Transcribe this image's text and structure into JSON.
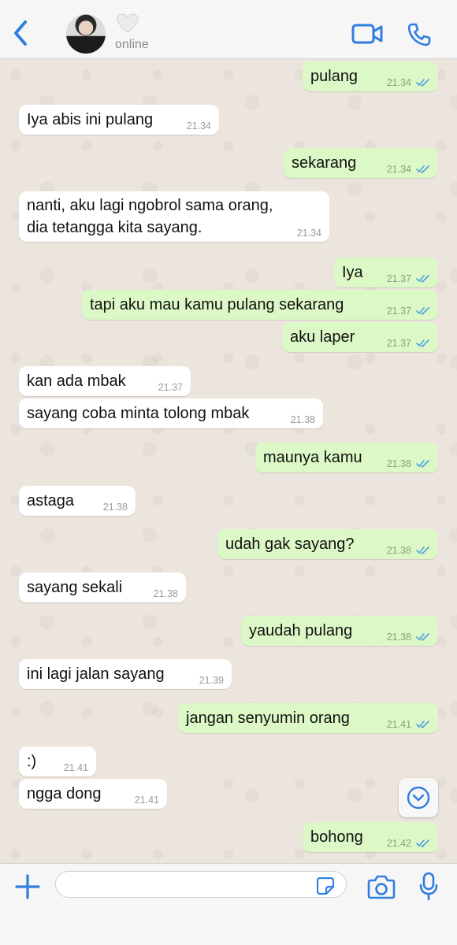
{
  "header": {
    "status": "online"
  },
  "icons": {
    "back": "chevron-left-icon",
    "heart": "heart-icon",
    "video": "video-camera-icon",
    "phone": "phone-icon",
    "plus": "plus-icon",
    "sticker": "sticker-icon",
    "camera": "camera-icon",
    "mic": "microphone-icon",
    "scroll": "chevron-down-circle-icon"
  },
  "colors": {
    "accent": "#2f7de1",
    "outgoing_bubble": "#dcf8c6",
    "incoming_bubble": "#ffffff",
    "tick_read": "#4fa3e0"
  },
  "messages": [
    {
      "dir": "out",
      "text": "pulang",
      "time": "21.34"
    },
    {
      "dir": "in",
      "text": "Iya abis ini pulang",
      "time": "21.34"
    },
    {
      "dir": "out",
      "text": "sekarang",
      "time": "21.34"
    },
    {
      "dir": "in",
      "text": "nanti, aku lagi ngobrol sama orang, dia tetangga kita sayang.",
      "time": "21.34"
    },
    {
      "dir": "out",
      "text": "Iya",
      "time": "21.37"
    },
    {
      "dir": "out",
      "text": "tapi aku mau kamu pulang sekarang",
      "time": "21.37"
    },
    {
      "dir": "out",
      "text": "aku laper",
      "time": "21.37"
    },
    {
      "dir": "in",
      "text": "kan ada mbak",
      "time": "21.37"
    },
    {
      "dir": "in",
      "text": "sayang coba minta tolong mbak",
      "time": "21.38"
    },
    {
      "dir": "out",
      "text": "maunya kamu",
      "time": "21.38"
    },
    {
      "dir": "in",
      "text": "astaga",
      "time": "21.38"
    },
    {
      "dir": "out",
      "text": "udah gak sayang?",
      "time": "21.38"
    },
    {
      "dir": "in",
      "text": "sayang sekali",
      "time": "21.38"
    },
    {
      "dir": "out",
      "text": "yaudah pulang",
      "time": "21.38"
    },
    {
      "dir": "in",
      "text": "ini lagi jalan sayang",
      "time": "21.39"
    },
    {
      "dir": "out",
      "text": "jangan senyumin orang",
      "time": "21.41"
    },
    {
      "dir": "in",
      "text": ":)",
      "time": "21.41"
    },
    {
      "dir": "in",
      "text": "ngga dong",
      "time": "21.41"
    },
    {
      "dir": "out",
      "text": "bohong",
      "time": "21.42"
    }
  ],
  "composer": {
    "value": "",
    "placeholder": ""
  }
}
